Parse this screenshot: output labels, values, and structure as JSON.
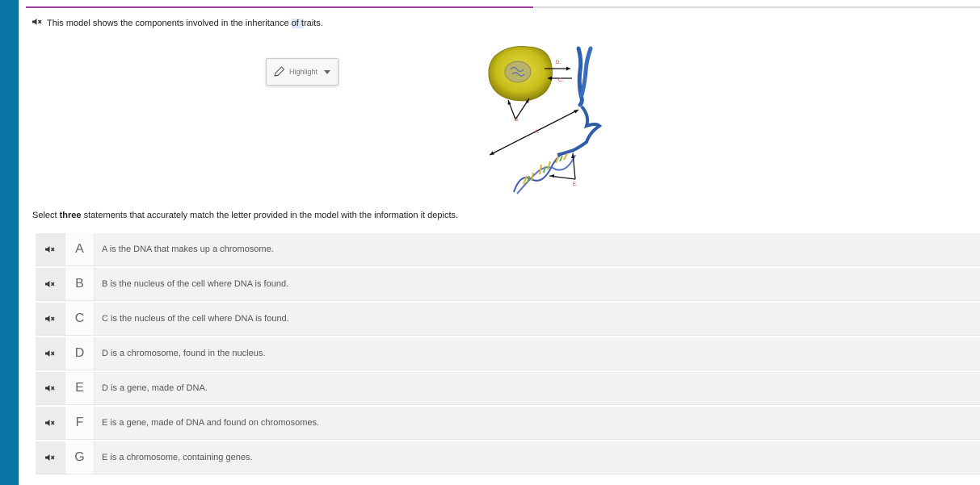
{
  "progress": {
    "fraction": 0.532,
    "fill_color": "#9b3a9b",
    "track_color": "#d9d9d9"
  },
  "sidebar": {
    "color": "#0a76a8"
  },
  "intro": {
    "icon": "speaker-mute-icon",
    "text_before": "This model shows the components involved in the inheritance ",
    "text_highlighted": "of t",
    "text_after": "raits."
  },
  "highlight_tool": {
    "icon": "pencil-icon",
    "label": "Highlight",
    "caret": "chevron-down-icon"
  },
  "model": {
    "labels": [
      "D.",
      "C.",
      "B.",
      "A.",
      "E."
    ],
    "label_color": "#c0392b"
  },
  "instruction": {
    "before": "Select ",
    "bold": "three",
    "after": " statements that accurately match the letter provided in the model with the information it depicts."
  },
  "options": [
    {
      "letter": "A",
      "text": "A is the DNA that makes up a chromosome."
    },
    {
      "letter": "B",
      "text": "B is the nucleus of the cell where DNA is found."
    },
    {
      "letter": "C",
      "text": "C is the nucleus of the cell where DNA is found."
    },
    {
      "letter": "D",
      "text": "D is a chromosome, found in the nucleus."
    },
    {
      "letter": "E",
      "text": "D is a gene, made of DNA."
    },
    {
      "letter": "F",
      "text": "E is a gene, made of DNA and found on chromosomes."
    },
    {
      "letter": "G",
      "text": "E is a chromosome, containing genes."
    }
  ]
}
